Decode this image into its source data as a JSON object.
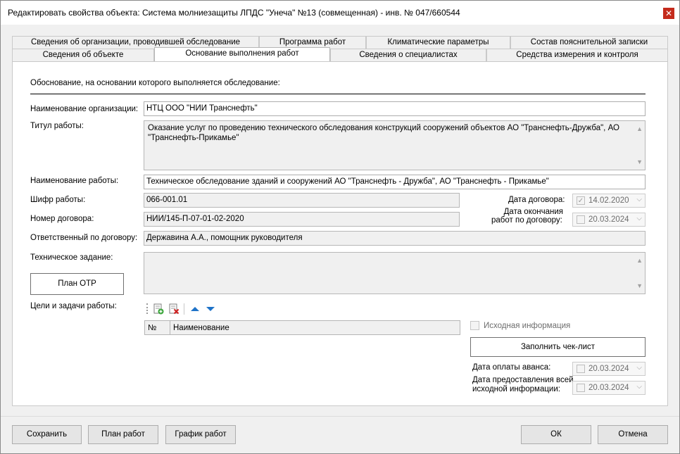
{
  "window": {
    "title": "Редактировать свойства объекта: Система молниезащиты ЛПДС \"Унеча\" №13 (совмещенная) - инв. № 047/660544",
    "close_glyph": "✕"
  },
  "tabs_row1": [
    {
      "label": "Сведения об организации, проводившей обследование"
    },
    {
      "label": "Программа работ"
    },
    {
      "label": "Климатические параметры"
    },
    {
      "label": "Состав пояснительной записки"
    }
  ],
  "tabs_row2": [
    {
      "label": "Сведения об объекте"
    },
    {
      "label": "Основание выполнения работ"
    },
    {
      "label": "Сведения о специалистах"
    },
    {
      "label": "Средства измерения и контроля"
    }
  ],
  "form": {
    "section_heading": "Обоснование, на основании которого выполняется обследование:",
    "org_name_label": "Наименование организации:",
    "org_name_value": "НТЦ ООО \"НИИ Транснефть\"",
    "work_title_label": "Титул работы:",
    "work_title_value": "Оказание услуг по проведению технического обследования конструкций сооружений объектов АО \"Транснефть-Дружба\", АО \"Транснефть-Прикамье\"",
    "work_name_label": "Наименование работы:",
    "work_name_value": "Техническое обследование зданий и сооружений АО \"Транснефть - Дружба\", АО \"Транснефть - Прикамье\"",
    "work_code_label": "Шифр работы:",
    "work_code_value": "066-001.01",
    "contract_no_label": "Номер договора:",
    "contract_no_value": "НИИ/145-П-07-01-02-2020",
    "responsible_label": "Ответственный по договору:",
    "responsible_value": "Державина А.А., помощник руководителя",
    "tech_task_label": "Техническое задание:",
    "tech_task_value": "",
    "plan_otr_button": "План ОТР",
    "goals_label": "Цели и задачи работы:",
    "contract_date_label": "Дата договора:",
    "contract_date_value": "14.02.2020",
    "contract_end_label_line1": "Дата окончания",
    "contract_end_label_line2": "работ по договору:",
    "contract_end_value": "20.03.2024",
    "source_info_label": "Исходная информация",
    "fill_checklist_button": "Заполнить чек-лист",
    "advance_date_label": "Дата оплаты аванса:",
    "advance_date_value": "20.03.2024",
    "source_date_label_line1": "Дата предоставления всей",
    "source_date_label_line2": "исходной информации:",
    "source_date_value": "20.03.2024"
  },
  "goals_table": {
    "columns": [
      "№",
      "Наименование"
    ]
  },
  "toolbar_icons": [
    "add-row-icon",
    "delete-row-icon",
    "move-up-icon",
    "move-down-icon"
  ],
  "footer": {
    "save_button": "Сохранить",
    "plan_button": "План работ",
    "schedule_button": "График работ",
    "ok_button": "ОК",
    "cancel_button": "Отмена"
  },
  "colors": {
    "close_button": "#c42b1c",
    "arrow_blue": "#1e73c8"
  }
}
